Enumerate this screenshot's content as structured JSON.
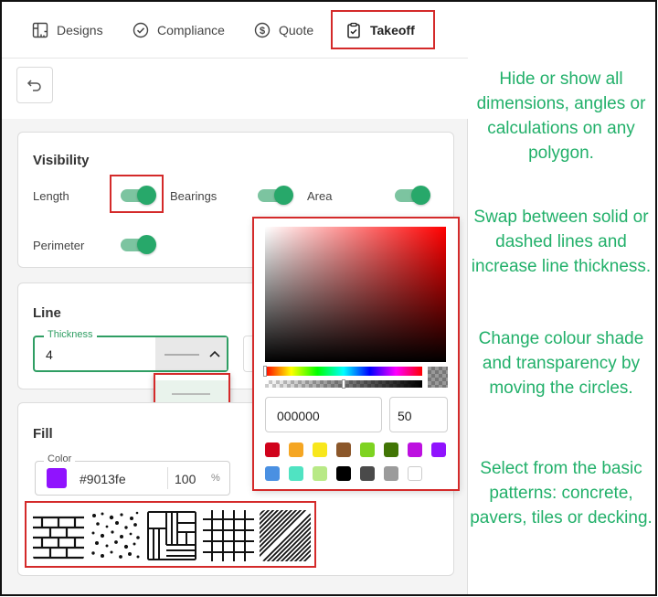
{
  "tabs": [
    {
      "label": "Designs",
      "icon": "ruler-square-icon"
    },
    {
      "label": "Compliance",
      "icon": "check-circle-icon"
    },
    {
      "label": "Quote",
      "icon": "dollar-circle-icon"
    },
    {
      "label": "Takeoff",
      "icon": "clipboard-check-icon",
      "active": true
    }
  ],
  "visibility": {
    "title": "Visibility",
    "length": "Length",
    "bearings": "Bearings",
    "area": "Area",
    "perimeter": "Perimeter"
  },
  "line": {
    "title": "Line",
    "thickness_label": "Thickness",
    "thickness_value": "4"
  },
  "fill": {
    "title": "Fill",
    "color_label": "Color",
    "color_hex": "#9013fe",
    "opacity": "100",
    "opacity_unit": "%"
  },
  "picker": {
    "hex_value": "000000",
    "alpha_value": "50",
    "swatches": [
      "#d0021b",
      "#f5a623",
      "#f8e71c",
      "#8b572a",
      "#7ed321",
      "#417505",
      "#bd10e0",
      "#9013fe",
      "#4a90e2",
      "#50e3c2",
      "#b8e986",
      "#000000",
      "#4a4a4a",
      "#9b9b9b",
      "#ffffff"
    ]
  },
  "notes": {
    "n1": "Hide or show all dimensions, angles or calculations on any polygon.",
    "n2": "Swap between solid or dashed lines and increase line thickness.",
    "n3": "Change colour shade and transparency by moving the circles.",
    "n4": "Select from the basic patterns: concrete, pavers, tiles or decking."
  },
  "colors": {
    "accent": "#27a86a",
    "highlight": "#d42a2a",
    "note_text": "#22b06a"
  }
}
